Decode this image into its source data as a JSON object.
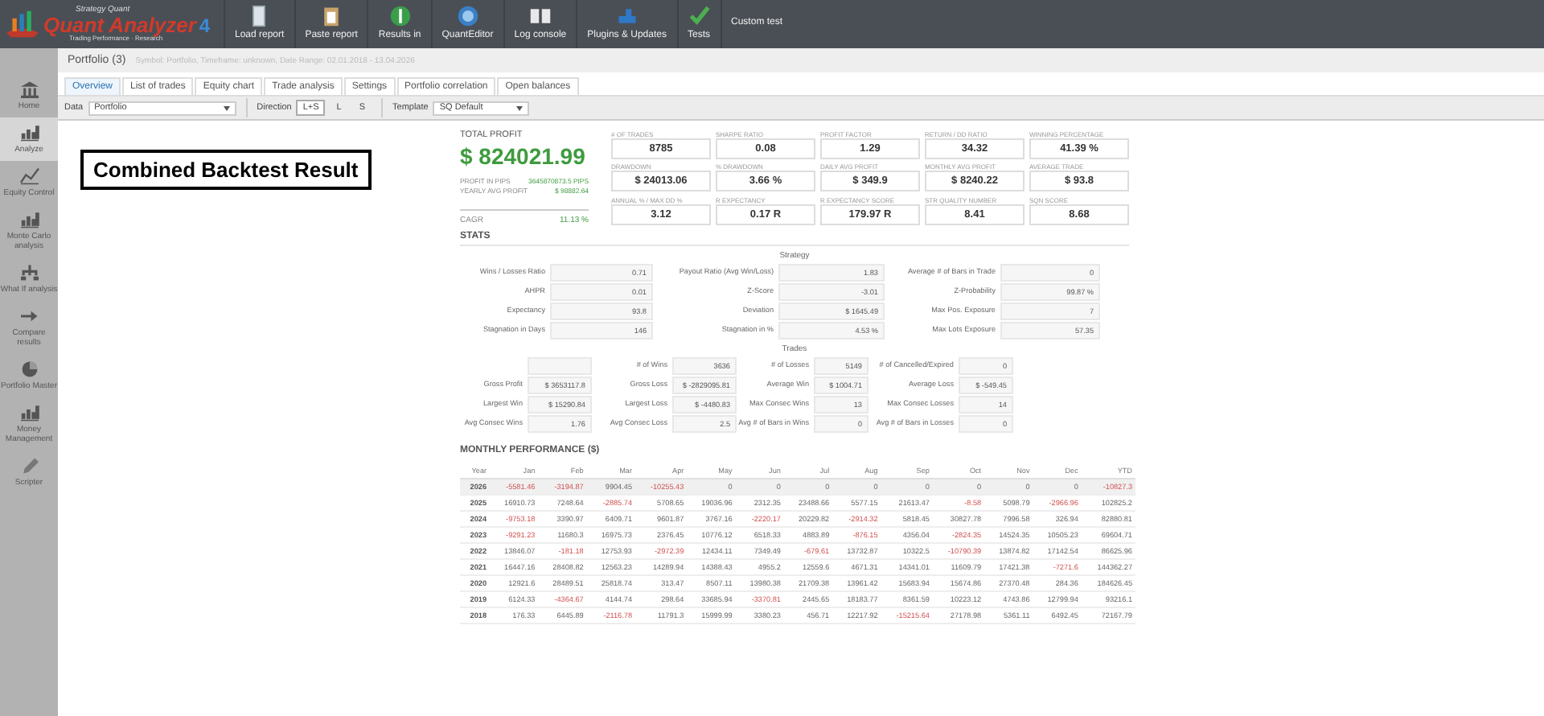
{
  "logo": {
    "top": "Strategy Quant",
    "name": "Quant Analyzer",
    "version": "4",
    "tagline": "Trading Performance · Research"
  },
  "toolbar": [
    {
      "label": "Load report",
      "icon": true
    },
    {
      "label": "Paste report",
      "icon": true
    },
    {
      "label": "Results in",
      "icon": true
    },
    {
      "label": "QuantEditor",
      "icon": true
    },
    {
      "label": "Log console",
      "icon": true
    },
    {
      "label": "Plugins & Updates",
      "icon": true
    },
    {
      "label": "Tests",
      "icon": true
    },
    {
      "label": "Custom test",
      "icon": false
    }
  ],
  "sidebar": {
    "items": [
      {
        "label": "Home",
        "selected": false
      },
      {
        "label": "Analyze",
        "selected": true
      },
      {
        "label": "Equity Control",
        "selected": false
      },
      {
        "label": "Monte Carlo analysis",
        "selected": false
      },
      {
        "label": "What If analysis",
        "selected": false
      },
      {
        "label": "Compare results",
        "selected": false
      },
      {
        "label": "Portfolio Master",
        "selected": false
      },
      {
        "label": "Money Management",
        "selected": false
      },
      {
        "label": "Scripter",
        "selected": false
      }
    ]
  },
  "header": {
    "title": "Portfolio (3)",
    "info": "Symbol: Portfolio, Timeframe: unknown, Date Range: 02.01.2018 - 13.04.2026"
  },
  "tabs": [
    {
      "label": "Overview",
      "selected": true
    },
    {
      "label": "List of trades",
      "selected": false
    },
    {
      "label": "Equity chart",
      "selected": false
    },
    {
      "label": "Trade analysis",
      "selected": false
    },
    {
      "label": "Settings",
      "selected": false
    },
    {
      "label": "Portfolio correlation",
      "selected": false
    },
    {
      "label": "Open balances",
      "selected": false
    }
  ],
  "filters": {
    "data_label": "Data",
    "data_value": "Portfolio",
    "direction_label": "Direction",
    "directions": [
      {
        "label": "L+S",
        "selected": true
      },
      {
        "label": "L",
        "selected": false
      },
      {
        "label": "S",
        "selected": false
      }
    ],
    "template_label": "Template",
    "template_value": "SQ Default"
  },
  "annotation": "Combined Backtest Result",
  "summary": {
    "total_profit_label": "TOTAL PROFIT",
    "total_profit": "$ 824021.99",
    "lines": [
      {
        "label": "PROFIT IN PIPS",
        "value": "3645870873.5 PIPS"
      },
      {
        "label": "YEARLY AVG PROFIT",
        "value": "$ 98882.64"
      }
    ],
    "cagr_label": "CAGR",
    "cagr": "11.13 %"
  },
  "metrics": [
    {
      "label": "# OF TRADES",
      "value": "8785"
    },
    {
      "label": "SHARPE RATIO",
      "value": "0.08"
    },
    {
      "label": "PROFIT FACTOR",
      "value": "1.29"
    },
    {
      "label": "RETURN / DD RATIO",
      "value": "34.32"
    },
    {
      "label": "WINNING PERCENTAGE",
      "value": "41.39 %"
    },
    {
      "label": "DRAWDOWN",
      "value": "$ 24013.06"
    },
    {
      "label": "% DRAWDOWN",
      "value": "3.66 %"
    },
    {
      "label": "DAILY AVG PROFIT",
      "value": "$ 349.9"
    },
    {
      "label": "MONTHLY AVG PROFIT",
      "value": "$ 8240.22"
    },
    {
      "label": "AVERAGE TRADE",
      "value": "$ 93.8"
    },
    {
      "label": "ANNUAL % / MAX DD %",
      "value": "3.12"
    },
    {
      "label": "R EXPECTANCY",
      "value": "0.17 R"
    },
    {
      "label": "R EXPECTANCY SCORE",
      "value": "179.97 R"
    },
    {
      "label": "STR QUALITY NUMBER",
      "value": "8.41"
    },
    {
      "label": "SQN SCORE",
      "value": "8.68"
    }
  ],
  "stats": {
    "title": "STATS",
    "strategy_title": "Strategy",
    "strategy": [
      [
        {
          "label": "Wins / Losses Ratio",
          "value": "0.71"
        },
        {
          "label": "Payout Ratio (Avg Win/Loss)",
          "value": "1.83"
        },
        {
          "label": "Average # of Bars in Trade",
          "value": "0"
        }
      ],
      [
        {
          "label": "AHPR",
          "value": "0.01"
        },
        {
          "label": "Z-Score",
          "value": "-3.01"
        },
        {
          "label": "Z-Probability",
          "value": "99.87 %"
        }
      ],
      [
        {
          "label": "Expectancy",
          "value": "93.8"
        },
        {
          "label": "Deviation",
          "value": "$ 1645.49"
        },
        {
          "label": "Max Pos. Exposure",
          "value": "7"
        }
      ],
      [
        {
          "label": "Stagnation in Days",
          "value": "146"
        },
        {
          "label": "Stagnation in %",
          "value": "4.53 %"
        },
        {
          "label": "Max Lots Exposure",
          "value": "57.35"
        }
      ]
    ],
    "trades_title": "Trades",
    "trades": [
      [
        {
          "label": "# of Wins",
          "value": "3636"
        },
        {
          "label": "# of Losses",
          "value": "5149"
        },
        {
          "label": "# of Cancelled/Expired",
          "value": "0"
        }
      ],
      [
        {
          "label": "Gross Profit",
          "value": "$ 3653117.8"
        },
        {
          "label": "Gross Loss",
          "value": "$ -2829095.81"
        },
        {
          "label": "Average Win",
          "value": "$ 1004.71"
        },
        {
          "label": "Average Loss",
          "value": "$ -549.45"
        }
      ],
      [
        {
          "label": "Largest Win",
          "value": "$ 15290.84"
        },
        {
          "label": "Largest Loss",
          "value": "$ -4480.83"
        },
        {
          "label": "Max Consec Wins",
          "value": "13"
        },
        {
          "label": "Max Consec Losses",
          "value": "14"
        }
      ],
      [
        {
          "label": "Avg Consec Wins",
          "value": "1.76"
        },
        {
          "label": "Avg Consec Loss",
          "value": "2.5"
        },
        {
          "label": "Avg # of Bars in Wins",
          "value": "0"
        },
        {
          "label": "Avg # of Bars in Losses",
          "value": "0"
        }
      ]
    ]
  },
  "monthly": {
    "title": "MONTHLY PERFORMANCE ($)",
    "columns": [
      "Year",
      "Jan",
      "Feb",
      "Mar",
      "Apr",
      "May",
      "Jun",
      "Jul",
      "Aug",
      "Sep",
      "Oct",
      "Nov",
      "Dec",
      "YTD"
    ],
    "rows": [
      {
        "selected": true,
        "cells": [
          {
            "t": "2026",
            "negative": false
          },
          {
            "t": "-5581.46",
            "negative": true
          },
          {
            "t": "-3194.87",
            "negative": true
          },
          {
            "t": "9904.45",
            "negative": false
          },
          {
            "t": "-10255.43",
            "negative": true
          },
          {
            "t": "0",
            "negative": false
          },
          {
            "t": "0",
            "negative": false
          },
          {
            "t": "0",
            "negative": false
          },
          {
            "t": "0",
            "negative": false
          },
          {
            "t": "0",
            "negative": false
          },
          {
            "t": "0",
            "negative": false
          },
          {
            "t": "0",
            "negative": false
          },
          {
            "t": "0",
            "negative": false
          },
          {
            "t": "-10827.3",
            "negative": true
          }
        ]
      },
      {
        "selected": false,
        "cells": [
          {
            "t": "2025",
            "negative": false
          },
          {
            "t": "16910.73",
            "negative": false
          },
          {
            "t": "7248.64",
            "negative": false
          },
          {
            "t": "-2885.74",
            "negative": true
          },
          {
            "t": "5708.65",
            "negative": false
          },
          {
            "t": "19036.96",
            "negative": false
          },
          {
            "t": "2312.35",
            "negative": false
          },
          {
            "t": "23488.66",
            "negative": false
          },
          {
            "t": "5577.15",
            "negative": false
          },
          {
            "t": "21613.47",
            "negative": false
          },
          {
            "t": "-8.58",
            "negative": true
          },
          {
            "t": "5098.79",
            "negative": false
          },
          {
            "t": "-2966.96",
            "negative": true
          },
          {
            "t": "102825.2",
            "negative": false
          }
        ]
      },
      {
        "selected": false,
        "cells": [
          {
            "t": "2024",
            "negative": false
          },
          {
            "t": "-9753.18",
            "negative": true
          },
          {
            "t": "3390.97",
            "negative": false
          },
          {
            "t": "6409.71",
            "negative": false
          },
          {
            "t": "9601.87",
            "negative": false
          },
          {
            "t": "3767.16",
            "negative": false
          },
          {
            "t": "-2220.17",
            "negative": true
          },
          {
            "t": "20229.82",
            "negative": false
          },
          {
            "t": "-2914.32",
            "negative": true
          },
          {
            "t": "5818.45",
            "negative": false
          },
          {
            "t": "30827.78",
            "negative": false
          },
          {
            "t": "7996.58",
            "negative": false
          },
          {
            "t": "326.94",
            "negative": false
          },
          {
            "t": "82880.81",
            "negative": false
          }
        ]
      },
      {
        "selected": false,
        "cells": [
          {
            "t": "2023",
            "negative": false
          },
          {
            "t": "-9291.23",
            "negative": true
          },
          {
            "t": "11680.3",
            "negative": false
          },
          {
            "t": "16975.73",
            "negative": false
          },
          {
            "t": "2376.45",
            "negative": false
          },
          {
            "t": "10776.12",
            "negative": false
          },
          {
            "t": "6518.33",
            "negative": false
          },
          {
            "t": "4883.89",
            "negative": false
          },
          {
            "t": "-876.15",
            "negative": true
          },
          {
            "t": "4356.04",
            "negative": false
          },
          {
            "t": "-2824.35",
            "negative": true
          },
          {
            "t": "14524.35",
            "negative": false
          },
          {
            "t": "10505.23",
            "negative": false
          },
          {
            "t": "69604.71",
            "negative": false
          }
        ]
      },
      {
        "selected": false,
        "cells": [
          {
            "t": "2022",
            "negative": false
          },
          {
            "t": "13846.07",
            "negative": false
          },
          {
            "t": "-181.18",
            "negative": true
          },
          {
            "t": "12753.93",
            "negative": false
          },
          {
            "t": "-2972.39",
            "negative": true
          },
          {
            "t": "12434.11",
            "negative": false
          },
          {
            "t": "7349.49",
            "negative": false
          },
          {
            "t": "-679.61",
            "negative": true
          },
          {
            "t": "13732.87",
            "negative": false
          },
          {
            "t": "10322.5",
            "negative": false
          },
          {
            "t": "-10790.39",
            "negative": true
          },
          {
            "t": "13874.82",
            "negative": false
          },
          {
            "t": "17142.54",
            "negative": false
          },
          {
            "t": "86625.96",
            "negative": false
          }
        ]
      },
      {
        "selected": false,
        "cells": [
          {
            "t": "2021",
            "negative": false
          },
          {
            "t": "16447.16",
            "negative": false
          },
          {
            "t": "28408.82",
            "negative": false
          },
          {
            "t": "12563.23",
            "negative": false
          },
          {
            "t": "14289.94",
            "negative": false
          },
          {
            "t": "14388.43",
            "negative": false
          },
          {
            "t": "4955.2",
            "negative": false
          },
          {
            "t": "12559.6",
            "negative": false
          },
          {
            "t": "4671.31",
            "negative": false
          },
          {
            "t": "14341.01",
            "negative": false
          },
          {
            "t": "11609.79",
            "negative": false
          },
          {
            "t": "17421.38",
            "negative": false
          },
          {
            "t": "-7271.6",
            "negative": true
          },
          {
            "t": "144362.27",
            "negative": false
          }
        ]
      },
      {
        "selected": false,
        "cells": [
          {
            "t": "2020",
            "negative": false
          },
          {
            "t": "12921.6",
            "negative": false
          },
          {
            "t": "28489.51",
            "negative": false
          },
          {
            "t": "25818.74",
            "negative": false
          },
          {
            "t": "313.47",
            "negative": false
          },
          {
            "t": "8507.11",
            "negative": false
          },
          {
            "t": "13980.38",
            "negative": false
          },
          {
            "t": "21709.38",
            "negative": false
          },
          {
            "t": "13961.42",
            "negative": false
          },
          {
            "t": "15683.94",
            "negative": false
          },
          {
            "t": "15674.86",
            "negative": false
          },
          {
            "t": "27370.48",
            "negative": false
          },
          {
            "t": "284.36",
            "negative": false
          },
          {
            "t": "184626.45",
            "negative": false
          }
        ]
      },
      {
        "selected": false,
        "cells": [
          {
            "t": "2019",
            "negative": false
          },
          {
            "t": "6124.33",
            "negative": false
          },
          {
            "t": "-4364.67",
            "negative": true
          },
          {
            "t": "4144.74",
            "negative": false
          },
          {
            "t": "298.64",
            "negative": false
          },
          {
            "t": "33685.94",
            "negative": false
          },
          {
            "t": "-3370.81",
            "negative": true
          },
          {
            "t": "2445.65",
            "negative": false
          },
          {
            "t": "18183.77",
            "negative": false
          },
          {
            "t": "8361.59",
            "negative": false
          },
          {
            "t": "10223.12",
            "negative": false
          },
          {
            "t": "4743.86",
            "negative": false
          },
          {
            "t": "12799.94",
            "negative": false
          },
          {
            "t": "93216.1",
            "negative": false
          }
        ]
      },
      {
        "selected": false,
        "cells": [
          {
            "t": "2018",
            "negative": false
          },
          {
            "t": "176.33",
            "negative": false
          },
          {
            "t": "6445.89",
            "negative": false
          },
          {
            "t": "-2116.78",
            "negative": true
          },
          {
            "t": "11791.3",
            "negative": false
          },
          {
            "t": "15999.99",
            "negative": false
          },
          {
            "t": "3380.23",
            "negative": false
          },
          {
            "t": "456.71",
            "negative": false
          },
          {
            "t": "12217.92",
            "negative": false
          },
          {
            "t": "-15215.64",
            "negative": true
          },
          {
            "t": "27178.98",
            "negative": false
          },
          {
            "t": "5361.11",
            "negative": false
          },
          {
            "t": "6492.45",
            "negative": false
          },
          {
            "t": "72167.79",
            "negative": false
          }
        ]
      }
    ]
  }
}
